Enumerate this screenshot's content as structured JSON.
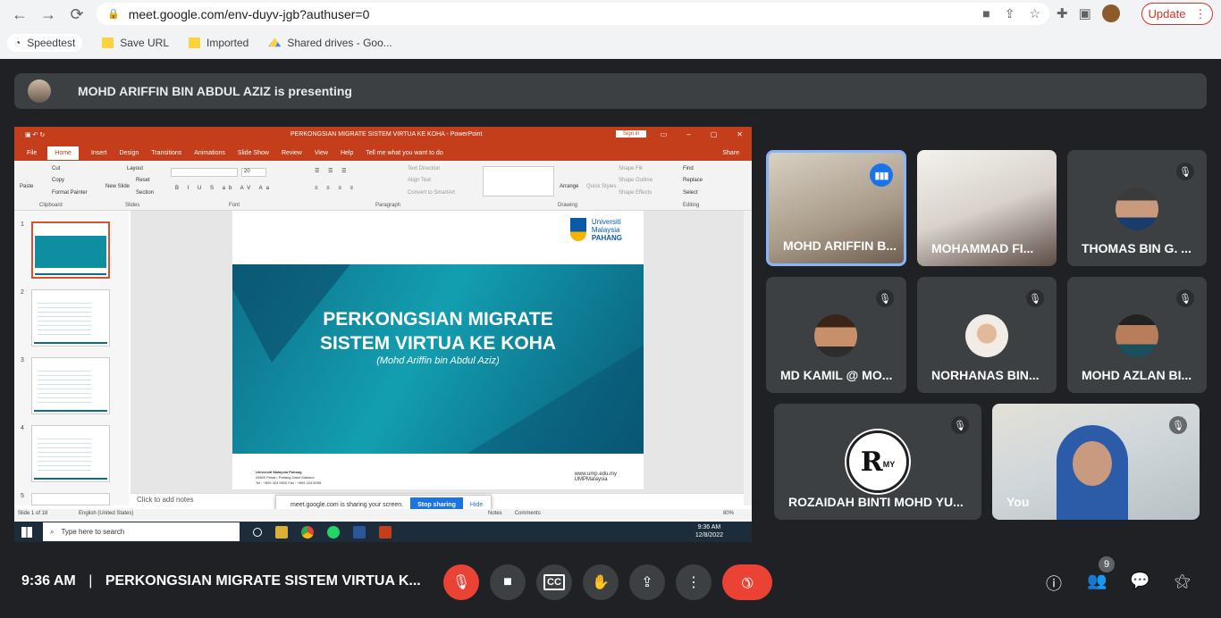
{
  "browser": {
    "url": "meet.google.com/env-duyv-jgb?authuser=0",
    "update_label": "Update",
    "bookmarks": [
      "Speedtest",
      "Save URL",
      "Imported",
      "Shared drives - Goo..."
    ]
  },
  "banner": {
    "text": "MOHD ARIFFIN BIN ABDUL AZIZ is presenting"
  },
  "ppt": {
    "title": "PERKONGSIAN MIGRATE SISTEM VIRTUA KE KOHA  -  PowerPoint",
    "sign_in": "Sign in",
    "share": "Share",
    "tabs": [
      "File",
      "Home",
      "Insert",
      "Design",
      "Transitions",
      "Animations",
      "Slide Show",
      "Review",
      "View",
      "Help",
      "Tell me what you want to do"
    ],
    "ribbon": {
      "clipboard": "Clipboard",
      "slides": "Slides",
      "font": "Font",
      "paragraph": "Paragraph",
      "drawing": "Drawing",
      "editing": "Editing",
      "paste": "Paste",
      "cut": "Cut",
      "copy": "Copy",
      "format_painter": "Format Painter",
      "new_slide": "New Slide",
      "layout": "Layout",
      "reset": "Reset",
      "section": "Section",
      "font_size": "20",
      "text_direction": "Text Direction",
      "align_text": "Align Text",
      "convert_smartart": "Convert to SmartArt",
      "arrange": "Arrange",
      "quick_styles": "Quick Styles",
      "shape_fill": "Shape Fill",
      "shape_outline": "Shape Outline",
      "shape_effects": "Shape Effects",
      "find": "Find",
      "replace": "Replace",
      "select": "Select"
    },
    "slide_numbers": [
      "1",
      "2",
      "3",
      "4",
      "5"
    ],
    "slide": {
      "title_line1": "PERKONGSIAN MIGRATE",
      "title_line2": "SISTEM VIRTUA KE KOHA",
      "subtitle": "(Mohd Ariffin bin Abdul Aziz)",
      "logo_line1": "Universiti",
      "logo_line2": "Malaysia",
      "logo_line3": "PAHANG",
      "footer_l1": "Universiti Malaysia Pahang",
      "footer_l2": "26600 Pekan, Pahang Darul Makmur",
      "footer_l3": "Tel : +609 424 5000  Fax : +609 424 5055",
      "footer_url": "www.ump.edu.my",
      "footer_handle": "UMPMalaysia"
    },
    "notes_placeholder": "Click to add notes",
    "status_slide": "Slide 1 of 18",
    "status_lang": "English (United States)",
    "status_notes": "Notes",
    "status_comments": "Comments",
    "zoom": "80%",
    "share_msg": "meet.google.com is sharing your screen.",
    "stop_sharing": "Stop sharing",
    "hide": "Hide",
    "taskbar_search": "Type here to search",
    "clock_time": "9:36 AM",
    "clock_date": "12/8/2022"
  },
  "participants": [
    {
      "name": "MOHD ARIFFIN B..."
    },
    {
      "name": "MOHAMMAD FI..."
    },
    {
      "name": "THOMAS BIN G. ..."
    },
    {
      "name": "MD KAMIL @ MO..."
    },
    {
      "name": "NORHANAS BIN..."
    },
    {
      "name": "MOHD AZLAN BI..."
    },
    {
      "name": "ROZAIDAH BINTI MOHD YU...",
      "initials": "R",
      "initials_sub": "MY"
    },
    {
      "name": "You"
    }
  ],
  "bottom": {
    "time": "9:36 AM",
    "separator": "|",
    "meeting": "PERKONGSIAN MIGRATE SISTEM VIRTUA K...",
    "people_count": "9"
  },
  "colors": {
    "meet_bg": "#202124",
    "tile_bg": "#3c4043",
    "ppt_red": "#c43e1c",
    "end_call": "#ea4335",
    "speaking": "#8ab4f8"
  }
}
